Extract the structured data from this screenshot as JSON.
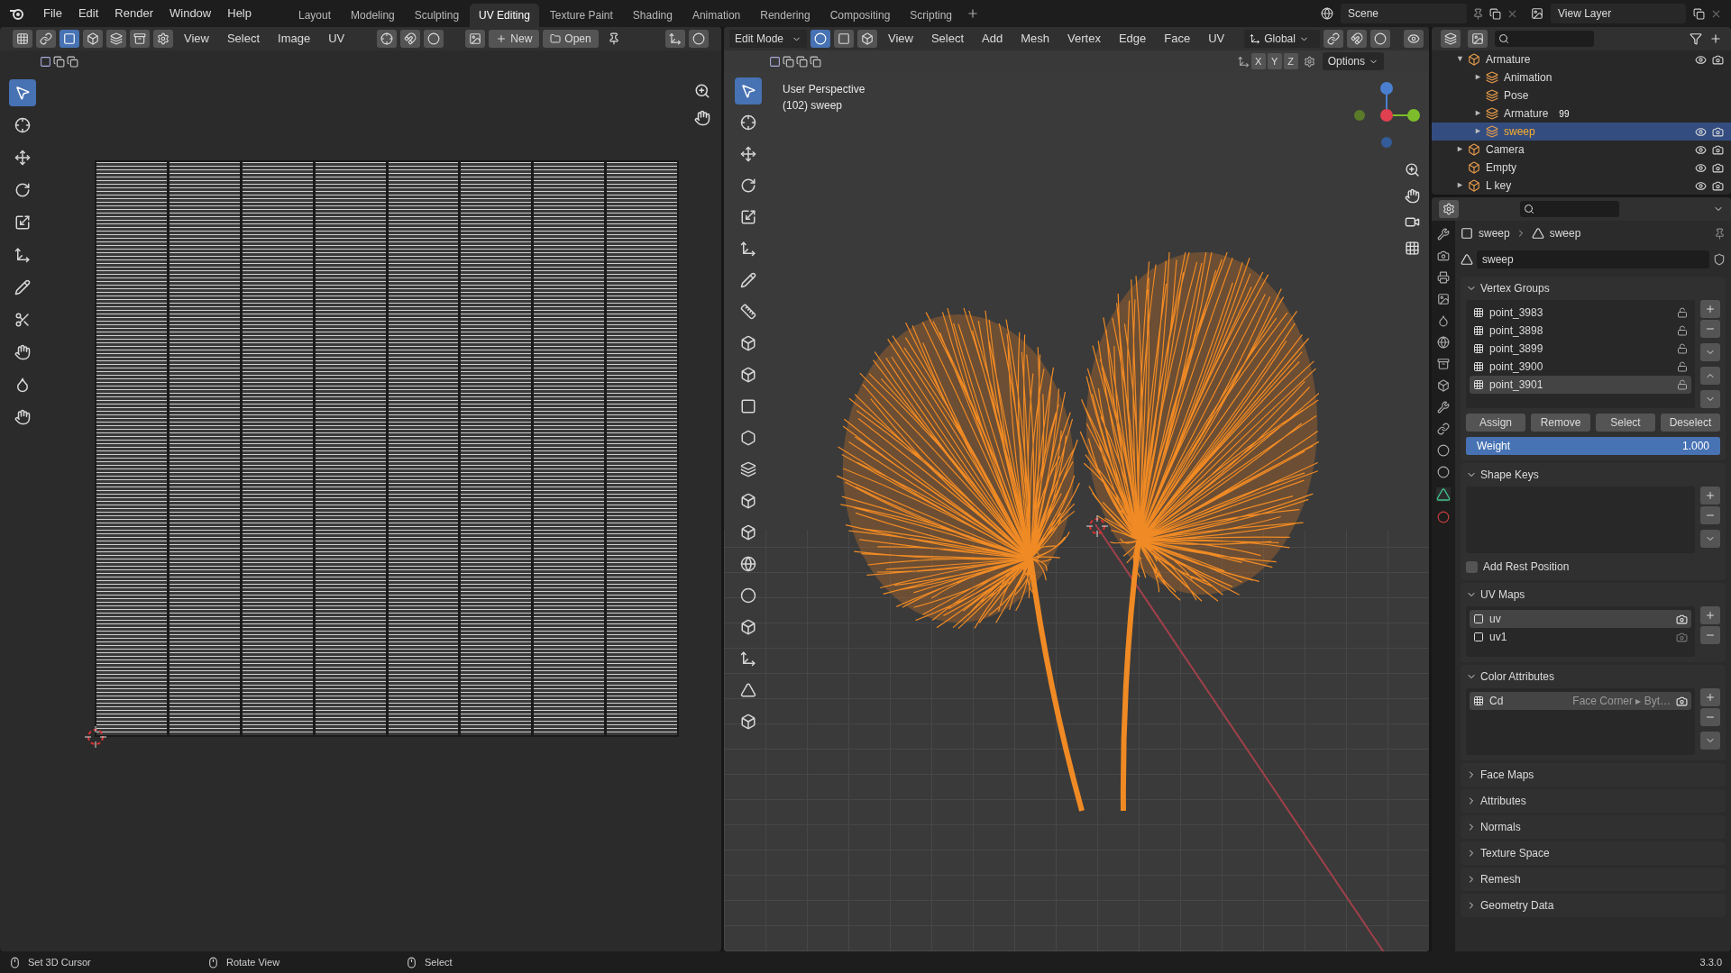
{
  "menu": [
    "File",
    "Edit",
    "Render",
    "Window",
    "Help"
  ],
  "workspaces": [
    {
      "label": "Layout",
      "selected": false
    },
    {
      "label": "Modeling",
      "selected": false
    },
    {
      "label": "Sculpting",
      "selected": false
    },
    {
      "label": "UV Editing",
      "selected": true
    },
    {
      "label": "Texture Paint",
      "selected": false
    },
    {
      "label": "Shading",
      "selected": false
    },
    {
      "label": "Animation",
      "selected": false
    },
    {
      "label": "Rendering",
      "selected": false
    },
    {
      "label": "Compositing",
      "selected": false
    },
    {
      "label": "Scripting",
      "selected": false
    }
  ],
  "scene": "Scene",
  "view_layer": "View Layer",
  "uv_editor": {
    "menus": [
      "View",
      "Select",
      "Image",
      "UV"
    ],
    "new_button": "New",
    "open_button": "Open",
    "select_modes": [
      {
        "selected": true
      },
      {
        "selected": false
      },
      {
        "selected": false
      },
      {
        "selected": false
      }
    ],
    "tools": [
      {
        "selected": true
      },
      {
        "selected": false
      },
      {
        "selected": false
      },
      {
        "selected": false
      },
      {
        "selected": false
      },
      {
        "selected": false
      },
      {
        "selected": false
      },
      {
        "selected": false
      },
      {
        "selected": false
      },
      {
        "selected": false
      },
      {
        "selected": false
      }
    ]
  },
  "viewport": {
    "mode": "Edit Mode",
    "menus": [
      "View",
      "Select",
      "Add",
      "Mesh",
      "Vertex",
      "Edge",
      "Face",
      "UV"
    ],
    "orientation": "Global",
    "axes": [
      "X",
      "Y",
      "Z"
    ],
    "options": "Options",
    "select_modes": [
      {
        "selected": true
      },
      {
        "selected": false
      },
      {
        "selected": false
      }
    ],
    "overlay_lines": [
      "User Perspective",
      "(102) sweep"
    ],
    "tools": [
      {
        "selected": true
      },
      {
        "selected": false
      },
      {
        "selected": false
      },
      {
        "selected": false
      },
      {
        "selected": false
      },
      {
        "selected": false
      },
      {
        "selected": false
      },
      {
        "selected": false
      },
      {
        "selected": false
      },
      {
        "selected": false
      },
      {
        "selected": false
      },
      {
        "selected": false
      },
      {
        "selected": false
      },
      {
        "selected": false
      },
      {
        "selected": false
      },
      {
        "selected": false
      },
      {
        "selected": false
      },
      {
        "selected": false
      },
      {
        "selected": false
      },
      {
        "selected": false
      },
      {
        "selected": false
      }
    ]
  },
  "outliner": {
    "items": [
      {
        "label": "Armature",
        "arrow": "▼",
        "selected": false,
        "children": [
          {
            "label": "Animation",
            "arrow": "►",
            "selected": false
          },
          {
            "label": "Pose",
            "selected": false
          },
          {
            "label": "Armature",
            "arrow": "►",
            "badge": "99",
            "selected": false
          },
          {
            "label": "sweep",
            "arrow": "►",
            "selected": true
          }
        ]
      },
      {
        "label": "Camera",
        "arrow": "►",
        "selected": false
      },
      {
        "label": "Empty",
        "selected": false
      },
      {
        "label": "L key",
        "arrow": "►",
        "selected": false
      }
    ]
  },
  "properties": {
    "breadcrumb": [
      "sweep",
      "sweep"
    ],
    "mesh_name": "sweep",
    "vertex_groups": {
      "title": "Vertex Groups",
      "expanded": true,
      "items": [
        {
          "label": "point_3983",
          "selected": false
        },
        {
          "label": "point_3898",
          "selected": false
        },
        {
          "label": "point_3899",
          "selected": false
        },
        {
          "label": "point_3900",
          "selected": false
        },
        {
          "label": "point_3901",
          "selected": true
        }
      ],
      "buttons": [
        "Assign",
        "Remove",
        "Select",
        "Deselect"
      ],
      "weight": {
        "label": "Weight",
        "value": "1.000",
        "level": 1
      }
    },
    "shape_keys": {
      "title": "Shape Keys",
      "expanded": true,
      "checkbox": {
        "label": "Add Rest Position",
        "checked": false
      }
    },
    "uv_maps": {
      "title": "UV Maps",
      "expanded": true,
      "items": [
        {
          "label": "uv",
          "selected": true
        },
        {
          "label": "uv1",
          "selected": false
        }
      ]
    },
    "color_attributes": {
      "title": "Color Attributes",
      "expanded": true,
      "items": [
        {
          "label": "Cd",
          "domain": "Face Corner ▸ Byt…",
          "selected": true
        }
      ]
    },
    "collapsed_panels": [
      {
        "title": "Face Maps",
        "expanded": false
      },
      {
        "title": "Attributes",
        "expanded": false
      },
      {
        "title": "Normals",
        "expanded": false
      },
      {
        "title": "Texture Space",
        "expanded": false
      },
      {
        "title": "Remesh",
        "expanded": false
      },
      {
        "title": "Geometry Data",
        "expanded": false
      }
    ]
  },
  "status_bar": {
    "hints": [
      "Set 3D Cursor",
      "Rotate View",
      "Select"
    ],
    "version": "3.3.0"
  }
}
